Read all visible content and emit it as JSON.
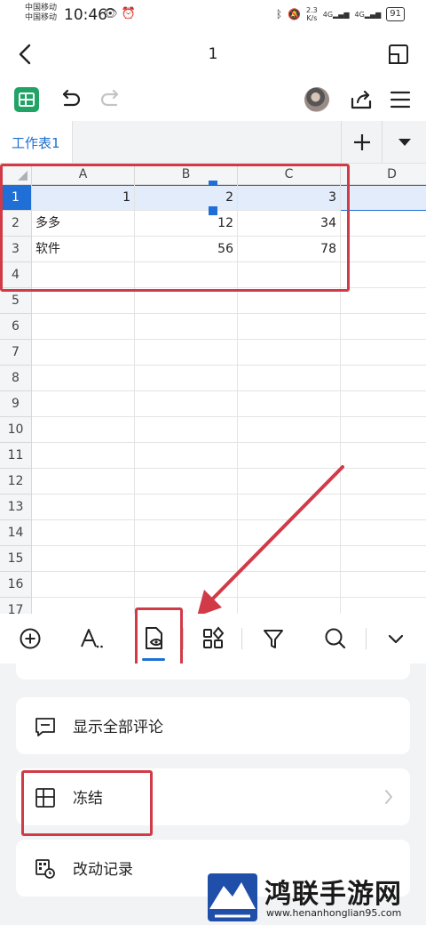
{
  "status_bar": {
    "carrier_1": "中国移动",
    "carrier_2": "中国移动",
    "time": "10:46",
    "speed_value": "2.3",
    "speed_unit": "K/s",
    "signal_1": "4G",
    "signal_2": "4G",
    "battery": "91"
  },
  "header": {
    "title": "1"
  },
  "sheet_tabs": {
    "active": "工作表1",
    "add_label": "+"
  },
  "spreadsheet": {
    "columns": [
      "A",
      "B",
      "C",
      "D"
    ],
    "row_numbers": [
      "1",
      "2",
      "3",
      "4",
      "5",
      "6",
      "7",
      "8",
      "9",
      "10",
      "11",
      "12",
      "13",
      "14",
      "15",
      "16",
      "17"
    ],
    "rows": [
      [
        "",
        "1",
        "2",
        "3",
        ""
      ],
      [
        "多多",
        "",
        "12",
        "34",
        ""
      ],
      [
        "软件",
        "",
        "56",
        "78",
        ""
      ],
      [
        "",
        "",
        "",
        "",
        ""
      ]
    ],
    "row1": {
      "a": "1",
      "b": "2",
      "c": "3"
    },
    "row2": {
      "a": "多多",
      "b": "12",
      "c": "34"
    },
    "row3": {
      "a": "软件",
      "b": "56",
      "c": "78"
    },
    "selected_row": "1"
  },
  "bottom_toolbar": {
    "items": [
      "add-icon",
      "text-format-icon",
      "view-icon",
      "widgets-icon",
      "filter-icon",
      "search-icon",
      "collapse-icon"
    ],
    "active": "view-icon"
  },
  "panel": {
    "items": [
      {
        "label": "显示全部评论",
        "icon": "comment-icon"
      },
      {
        "label": "冻结",
        "icon": "freeze-icon"
      },
      {
        "label": "改动记录",
        "icon": "history-icon"
      }
    ]
  },
  "watermark": {
    "name": "鸿联手游网",
    "url": "www.henanhonglian95.com"
  },
  "colors": {
    "accent": "#1f6fd6",
    "annotation": "#d13a47",
    "app": "#21a366"
  }
}
